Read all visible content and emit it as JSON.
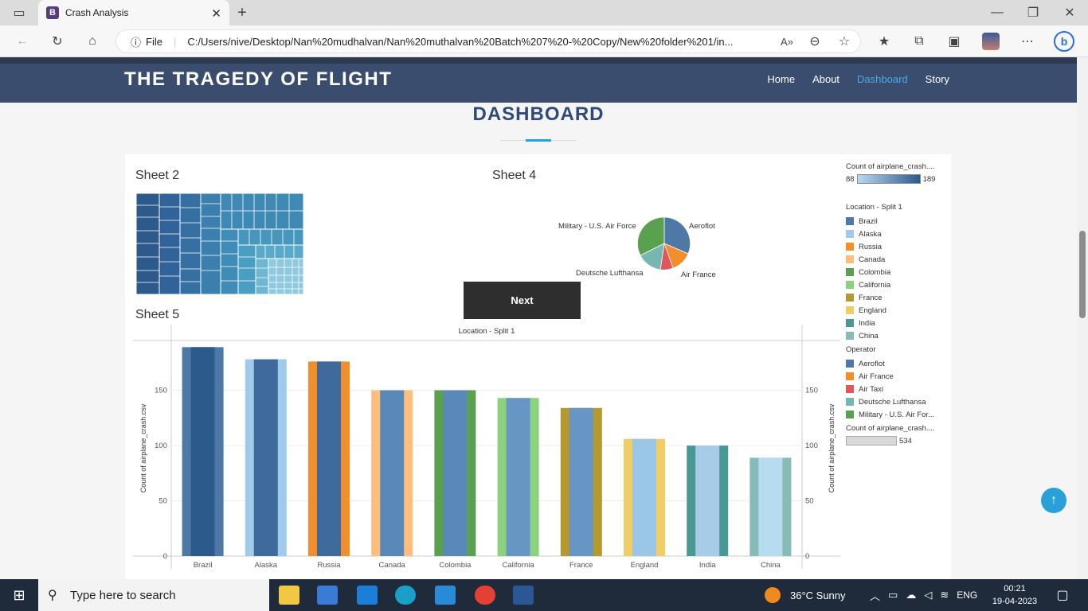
{
  "browser": {
    "tab_title": "Crash Analysis",
    "tab_favicon": "B",
    "file_label": "File",
    "url": "C:/Users/nive/Desktop/Nan%20mudhalvan/Nan%20muthalvan%20Batch%207%20-%20Copy/New%20folder%201/in..."
  },
  "site": {
    "brand": "THE TRAGEDY OF FLIGHT",
    "nav": [
      "Home",
      "About",
      "Dashboard",
      "Story"
    ],
    "page_title": "DASHBOARD"
  },
  "dashboard": {
    "sheet2_title": "Sheet 2",
    "sheet4_title": "Sheet 4",
    "sheet5_title": "Sheet 5",
    "next_label": "Next",
    "pie_labels": [
      "Military - U.S. Air Force",
      "Aeroflot",
      "Deutsche Lufthansa",
      "Air France"
    ]
  },
  "legend": {
    "count_header": "Count of airplane_crash....",
    "count_min": "88",
    "count_max": "189",
    "location_header": "Location - Split 1",
    "locations": [
      {
        "label": "Brazil",
        "color": "#4e79a7"
      },
      {
        "label": "Alaska",
        "color": "#a0cbe8"
      },
      {
        "label": "Russia",
        "color": "#f28e2b"
      },
      {
        "label": "Canada",
        "color": "#ffbe7d"
      },
      {
        "label": "Colombia",
        "color": "#59a14f"
      },
      {
        "label": "California",
        "color": "#8cd17d"
      },
      {
        "label": "France",
        "color": "#b6992d"
      },
      {
        "label": "England",
        "color": "#f1ce63"
      },
      {
        "label": "India",
        "color": "#499894"
      },
      {
        "label": "China",
        "color": "#86bcb6"
      }
    ],
    "operator_header": "Operator",
    "operators": [
      {
        "label": "Aeroflot",
        "color": "#4e79a7"
      },
      {
        "label": "Air France",
        "color": "#f28e2b"
      },
      {
        "label": "Air Taxi",
        "color": "#e15759"
      },
      {
        "label": "Deutsche Lufthansa",
        "color": "#76b7b2"
      },
      {
        "label": "Military - U.S. Air For...",
        "color": "#59a14f"
      }
    ],
    "count2_header": "Count of airplane_crash....",
    "count2_value": "534"
  },
  "chart_data": {
    "type": "bar",
    "title": "Location - Split 1",
    "ylabel": "Count of airplane_crash.csv",
    "categories": [
      "Brazil",
      "Alaska",
      "Russia",
      "Canada",
      "Colombia",
      "California",
      "France",
      "England",
      "India",
      "China"
    ],
    "values": [
      189,
      178,
      176,
      150,
      150,
      143,
      134,
      106,
      100,
      89
    ],
    "colors": [
      "#4e79a7",
      "#a0cbe8",
      "#f28e2b",
      "#ffbe7d",
      "#59a14f",
      "#8cd17d",
      "#b6992d",
      "#f1ce63",
      "#499894",
      "#86bcb6"
    ],
    "inner_colors": [
      "#2c5a8a",
      "#3e6a9c",
      "#3e6a9c",
      "#5a88b8",
      "#5a88b8",
      "#6896c4",
      "#6896c4",
      "#9cc6e6",
      "#a6cce8",
      "#b8dcef"
    ],
    "yticks": [
      0,
      50,
      100,
      150
    ],
    "ylim": [
      0,
      195
    ]
  },
  "taskbar": {
    "search_placeholder": "Type here to search",
    "weather": "36°C  Sunny",
    "lang": "ENG",
    "time": "00:21",
    "date": "19-04-2023"
  }
}
